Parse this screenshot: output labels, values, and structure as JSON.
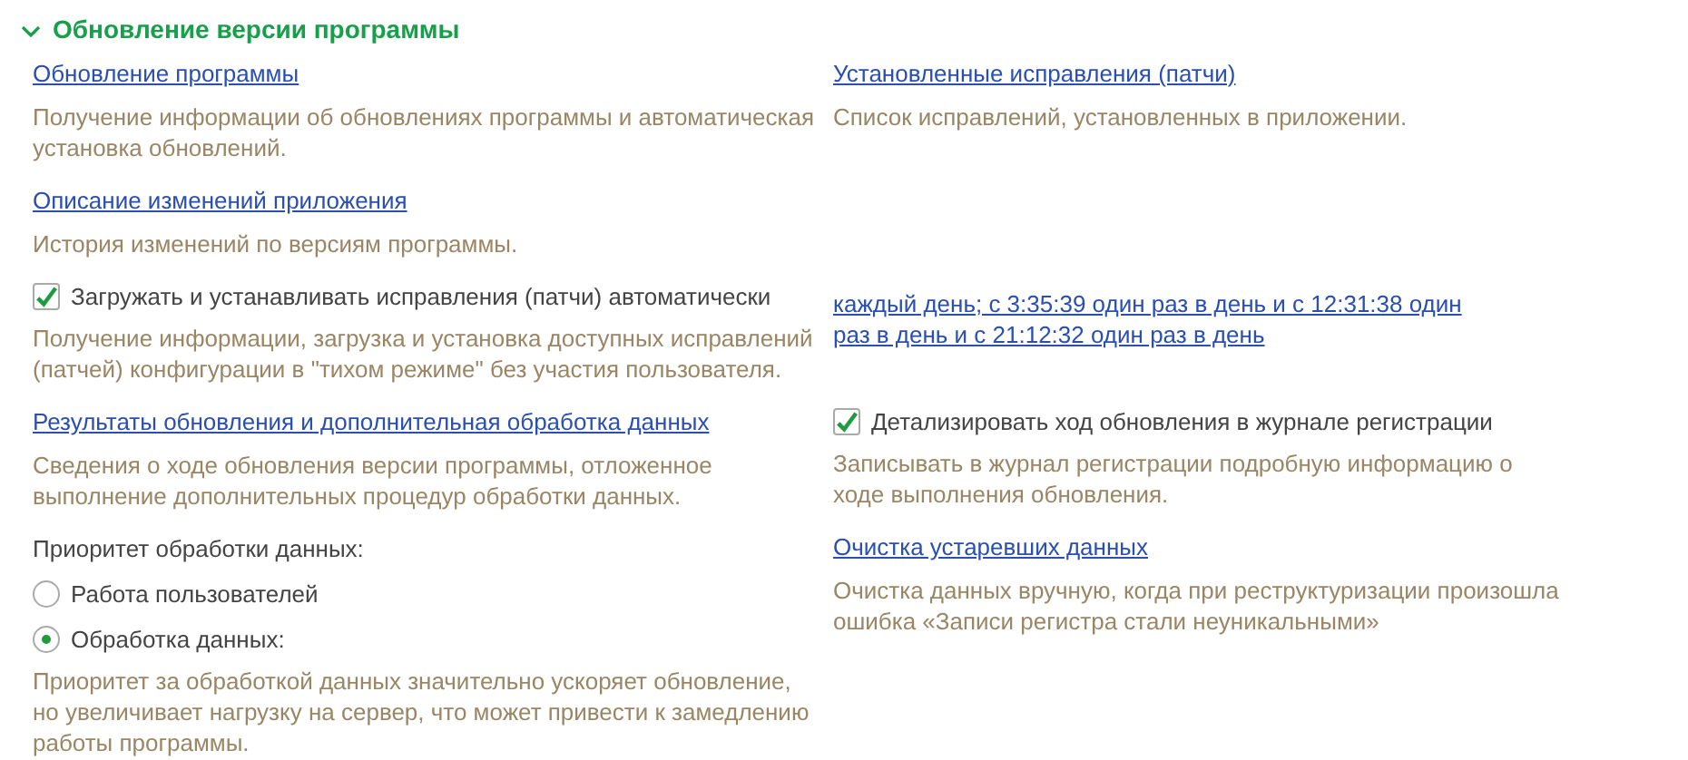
{
  "section": {
    "title": "Обновление версии программы",
    "expanded": true
  },
  "rows": [
    {
      "left": [
        {
          "kind": "link",
          "text": "Обновление программы"
        },
        {
          "kind": "description",
          "text": "Получение информации об обновлениях программы и автоматическая установка обновлений."
        }
      ],
      "right": [
        {
          "kind": "link",
          "text": "Установленные исправления (патчи)"
        },
        {
          "kind": "description",
          "text": "Список исправлений, установленных в приложении."
        }
      ]
    },
    {
      "left": [
        {
          "kind": "link",
          "text": "Описание изменений приложения"
        },
        {
          "kind": "description",
          "text": "История изменений по версиям программы."
        }
      ],
      "right": []
    },
    {
      "left": [
        {
          "kind": "checkbox",
          "text": "Загружать и устанавливать исправления (патчи) автоматически",
          "checked": true
        },
        {
          "kind": "description",
          "text": "Получение информации, загрузка и установка доступных исправлений (патчей) конфигурации в \"тихом режиме\" без участия пользователя."
        }
      ],
      "right": [
        {
          "kind": "schedule",
          "text": "каждый день; с 3:35:39 один раз в день и с 12:31:38 один раз в день и с 21:12:32 один раз в день"
        }
      ]
    },
    {
      "left": [
        {
          "kind": "link",
          "text": "Результаты обновления и дополнительная обработка данных"
        },
        {
          "kind": "description",
          "text": "Сведения о ходе обновления версии программы, отложенное выполнение дополнительных процедур обработки данных."
        },
        {
          "kind": "label",
          "text": "Приоритет обработки данных:"
        },
        {
          "kind": "radio",
          "text": "Работа пользователей",
          "selected": false
        },
        {
          "kind": "radio",
          "text": "Обработка данных:",
          "selected": true
        },
        {
          "kind": "description",
          "text": "Приоритет за обработкой данных значительно ускоряет обновление, но увеличивает нагрузку на сервер, что может привести к замедлению работы программы."
        }
      ],
      "right": [
        {
          "kind": "checkbox",
          "text": "Детализировать ход обновления в журнале регистрации",
          "checked": true
        },
        {
          "kind": "description",
          "text": "Записывать в журнал регистрации подробную информацию о ходе выполнения обновления."
        },
        {
          "kind": "link",
          "text": "Очистка устаревших данных"
        },
        {
          "kind": "description",
          "text": "Очистка данных вручную, когда при реструктуризации произошла ошибка «Записи регистра стали неуникальными»"
        }
      ]
    }
  ]
}
